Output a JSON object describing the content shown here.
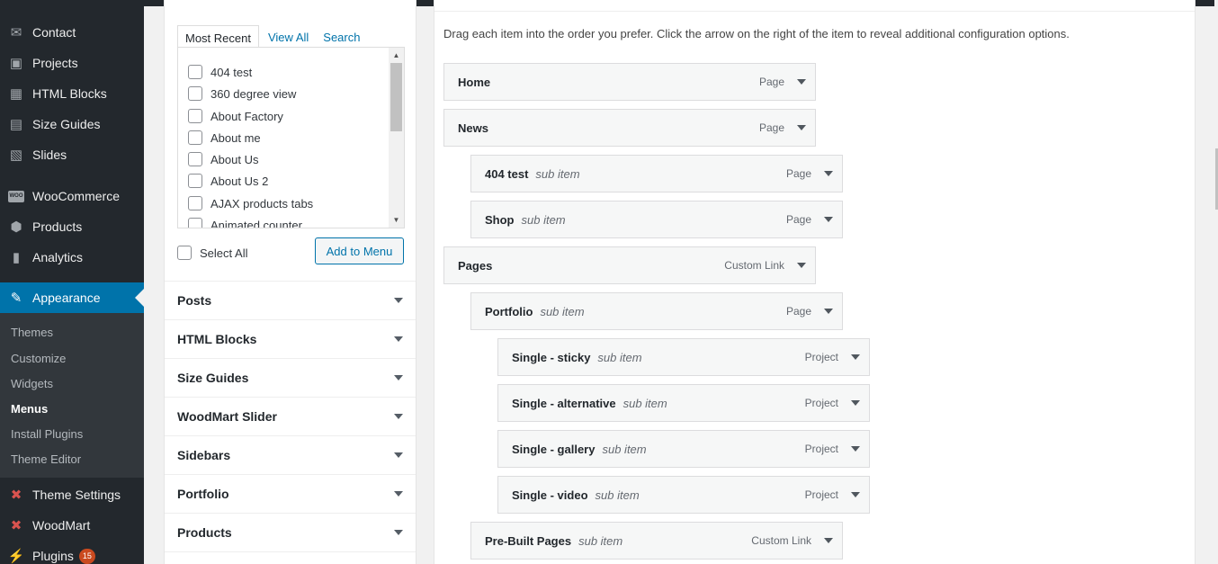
{
  "sidebar": {
    "items": [
      {
        "label": "Contact",
        "icon": "envelope-icon"
      },
      {
        "label": "Projects",
        "icon": "projects-icon"
      },
      {
        "label": "HTML Blocks",
        "icon": "grid-icon"
      },
      {
        "label": "Size Guides",
        "icon": "ruler-icon"
      },
      {
        "label": "Slides",
        "icon": "slides-icon"
      },
      {
        "label": "WooCommerce",
        "icon": "woocommerce-icon"
      },
      {
        "label": "Products",
        "icon": "box-icon"
      },
      {
        "label": "Analytics",
        "icon": "bar-chart-icon"
      },
      {
        "label": "Appearance",
        "icon": "paintbrush-icon"
      },
      {
        "label": "Theme Settings",
        "icon": "theme-settings-icon"
      },
      {
        "label": "WoodMart",
        "icon": "woodmart-icon"
      },
      {
        "label": "Plugins",
        "icon": "plug-icon",
        "badge": "15"
      }
    ],
    "submenu": [
      "Themes",
      "Customize",
      "Widgets",
      "Menus",
      "Install Plugins",
      "Theme Editor"
    ],
    "woo_logo_text": "WOO"
  },
  "add_items": {
    "tabs": [
      "Most Recent",
      "View All",
      "Search"
    ],
    "pages": [
      "404 test",
      "360 degree view",
      "About Factory",
      "About me",
      "About Us",
      "About Us 2",
      "AJAX products tabs",
      "Animated counter"
    ],
    "select_all": "Select All",
    "add_button": "Add to Menu",
    "panels": [
      "Posts",
      "HTML Blocks",
      "Size Guides",
      "WoodMart Slider",
      "Sidebars",
      "Portfolio",
      "Products"
    ]
  },
  "menu_structure": {
    "instructions": "Drag each item into the order you prefer. Click the arrow on the right of the item to reveal additional configuration options.",
    "items": [
      {
        "title": "Home",
        "sub": "",
        "type": "Page"
      },
      {
        "title": "News",
        "sub": "",
        "type": "Page"
      },
      {
        "title": "404 test",
        "sub": "sub item",
        "type": "Page"
      },
      {
        "title": "Shop",
        "sub": "sub item",
        "type": "Page"
      },
      {
        "title": "Pages",
        "sub": "",
        "type": "Custom Link"
      },
      {
        "title": "Portfolio",
        "sub": "sub item",
        "type": "Page"
      },
      {
        "title": "Single - sticky",
        "sub": "sub item",
        "type": "Project"
      },
      {
        "title": "Single - alternative",
        "sub": "sub item",
        "type": "Project"
      },
      {
        "title": "Single - gallery",
        "sub": "sub item",
        "type": "Project"
      },
      {
        "title": "Single - video",
        "sub": "sub item",
        "type": "Project"
      },
      {
        "title": "Pre-Built Pages",
        "sub": "sub item",
        "type": "Custom Link"
      }
    ]
  },
  "colors": {
    "accent": "#0073aa",
    "sidebar_bg": "#23282d",
    "badge": "#ca4a1f"
  }
}
